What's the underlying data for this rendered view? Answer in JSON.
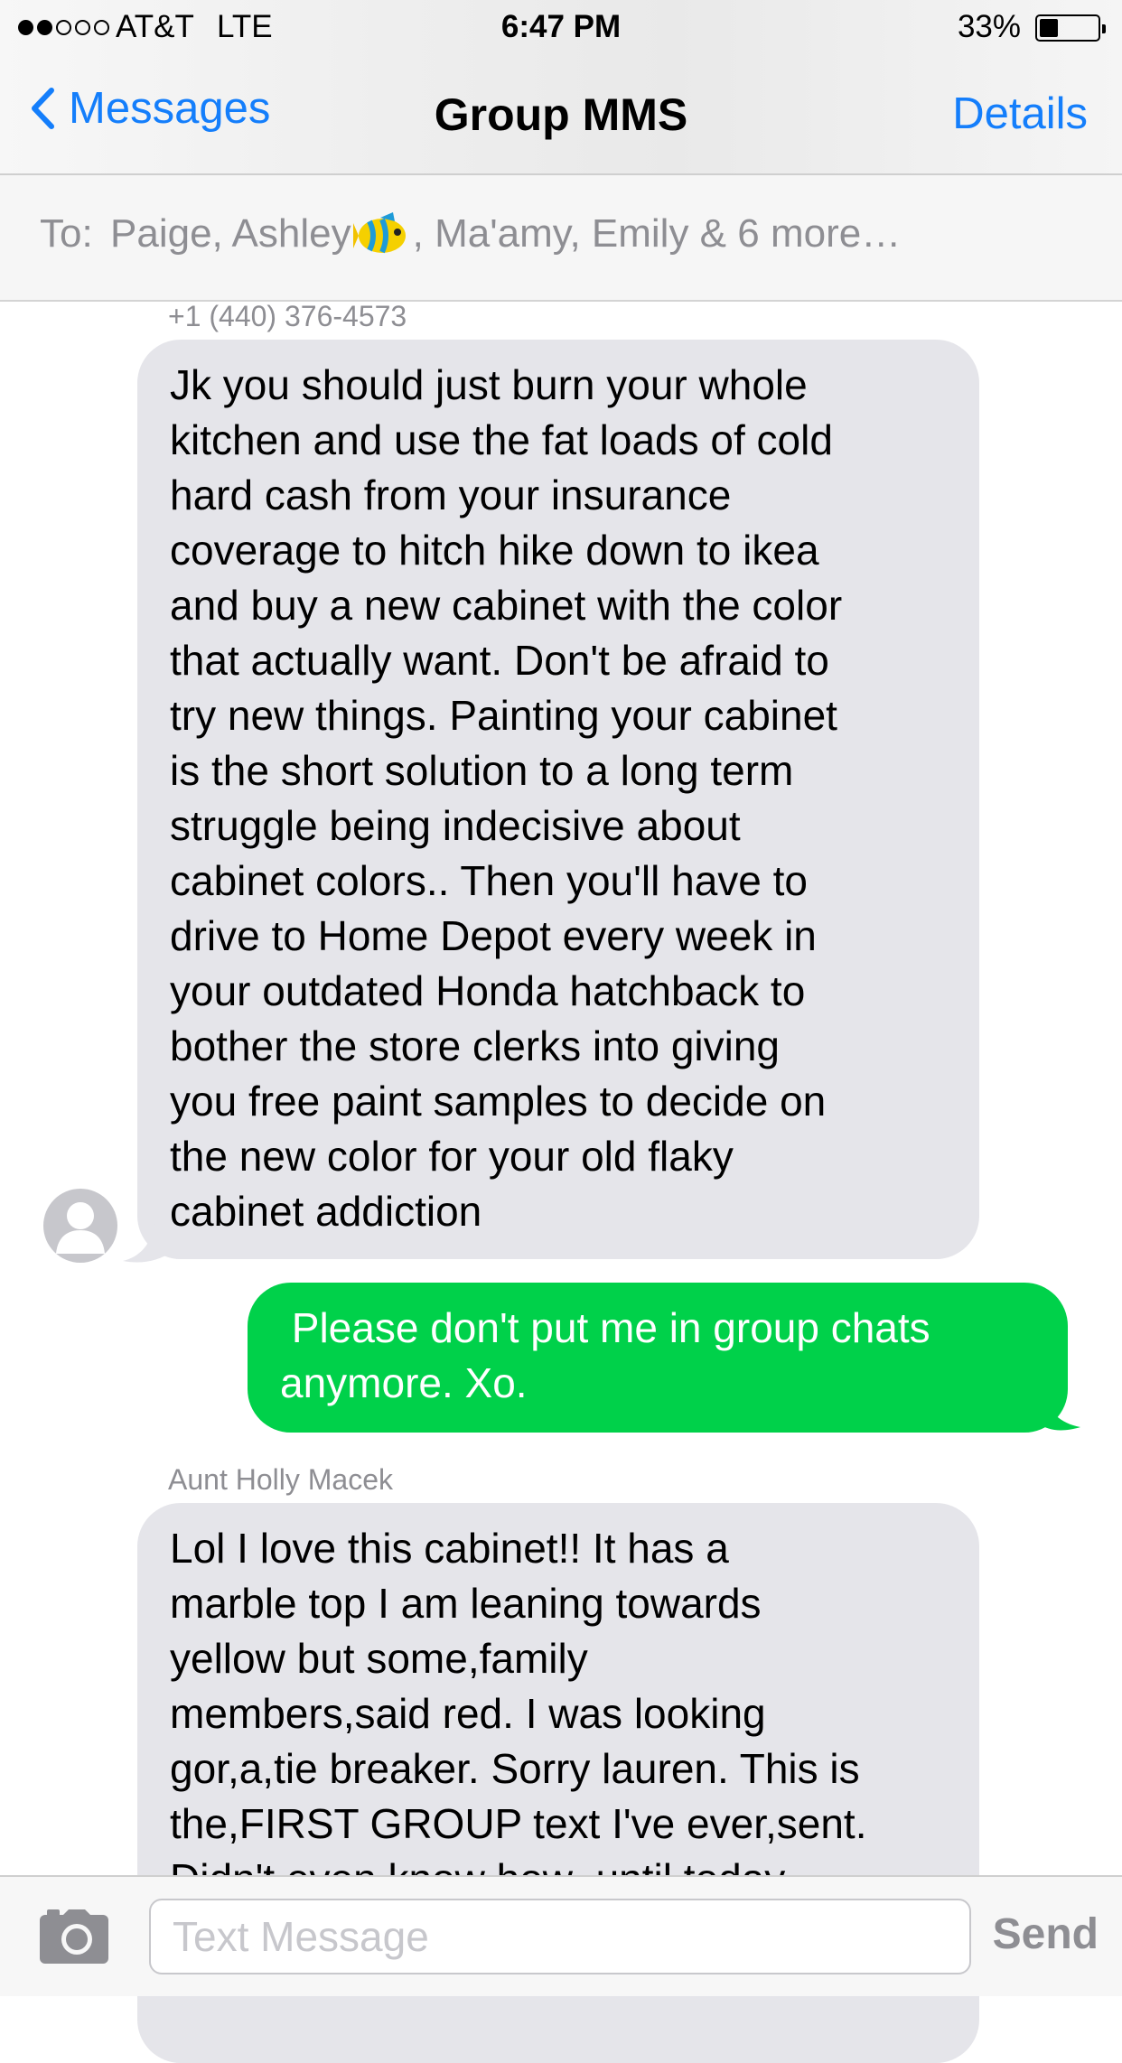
{
  "status_bar": {
    "signal_dots": [
      true,
      true,
      false,
      false,
      false
    ],
    "carrier": "AT&T",
    "network": "LTE",
    "time": "6:47 PM",
    "battery_percent_text": "33%",
    "battery_level": 0.33
  },
  "nav": {
    "back_label": "Messages",
    "title": "Group MMS",
    "details_label": "Details"
  },
  "recipients": {
    "to_label": "To:",
    "names_before_icon": "Paige, Ashley",
    "names_after_icon": ", Ma'amy, Emily & 6 more…",
    "icon": "tropical-fish-emoji"
  },
  "messages": [
    {
      "direction": "incoming",
      "sender": "+1 (440) 376-4573",
      "lines": [
        "Jk you should just burn your whole",
        "kitchen and use the fat loads of cold",
        "hard cash from your insurance",
        "coverage to hitch hike down to ikea",
        "and buy a new cabinet with the color",
        "that actually want. Don't be afraid to",
        "try new things. Painting your cabinet",
        "is the short solution to a long term",
        "struggle being indecisive about",
        "cabinet colors.. Then you'll have to",
        "drive to Home Depot every week in",
        "your outdated Honda hatchback to",
        "bother the store clerks into giving",
        "you free paint samples to decide on",
        "the new color for your old flaky",
        "cabinet addiction"
      ]
    },
    {
      "direction": "outgoing",
      "lines": [
        " Please don't put me in group chats",
        "anymore. Xo."
      ]
    },
    {
      "direction": "incoming",
      "sender": "Aunt Holly Macek",
      "lines": [
        "Lol I love this cabinet!! It has a",
        "marble top I am leaning towards",
        "yellow but some,family",
        "members,said red. I was looking",
        "gor,a,tie breaker. Sorry lauren. This is",
        "the,FIRST GROUP text I've ever,sent.",
        "Didn't even know how  until today"
      ]
    }
  ],
  "composer": {
    "placeholder": "Text Message",
    "send_label": "Send"
  },
  "colors": {
    "accent_blue": "#147efb",
    "incoming_bubble": "#e5e5ea",
    "outgoing_bubble": "#00d14a",
    "muted_text": "#8e8e93"
  }
}
